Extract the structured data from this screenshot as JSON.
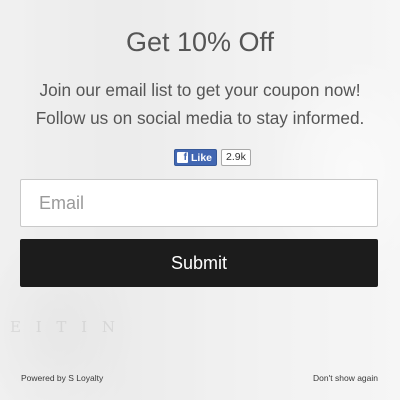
{
  "popup": {
    "title": "Get 10% Off",
    "subtitle_line1": "Join our email list to get your coupon now!",
    "subtitle_line2": "Follow us on social media to stay informed."
  },
  "facebook": {
    "icon_letter": "f",
    "like_label": "Like",
    "like_count": "2.9k",
    "icon": "facebook-icon",
    "brand_color": "#4267b2"
  },
  "form": {
    "email_placeholder": "Email",
    "email_value": "",
    "submit_label": "Submit",
    "submit_color": "#1c1c1c"
  },
  "footer": {
    "powered_by": "Powered by S Loyalty",
    "dont_show": "Don't show again"
  }
}
